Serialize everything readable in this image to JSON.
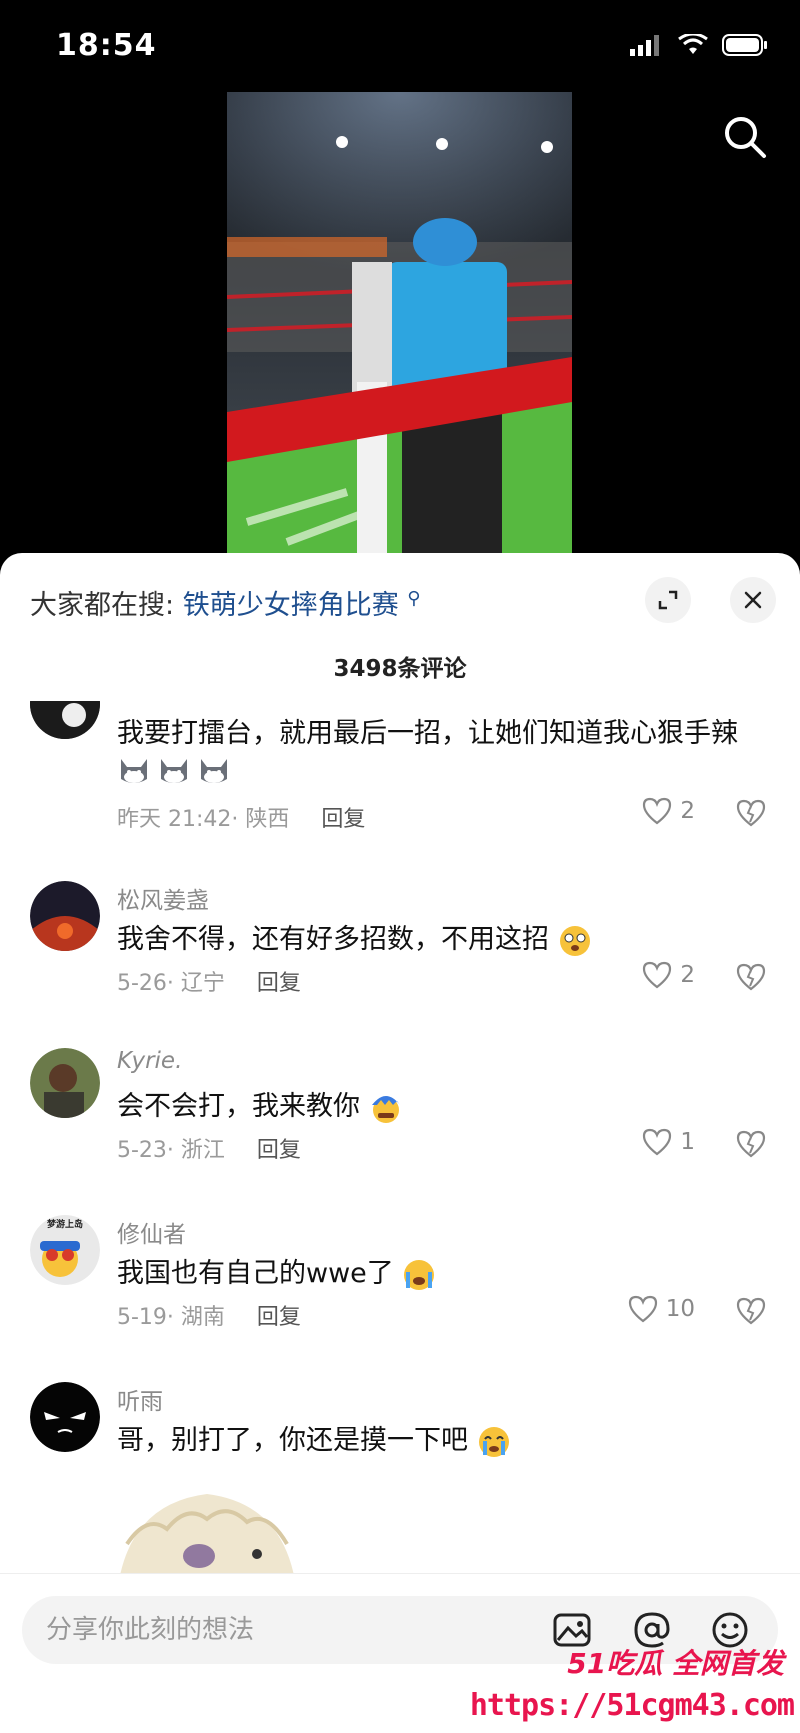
{
  "status_bar": {
    "time": "18:54"
  },
  "sheet": {
    "hot_search_prefix": "大家都在搜:",
    "hot_search_term": "铁萌少女摔角比赛",
    "comment_count": "3498条评论"
  },
  "comments": [
    {
      "username": "",
      "text": "我要打擂台，就用最后一招，让她们知道我心狠手辣",
      "emoji": "cat-face-x3",
      "time_location": "昨天 21:42· 陕西",
      "reply": "回复",
      "likes": "2"
    },
    {
      "username": "松风姜盏",
      "text": "我舍不得，还有好多招数，不用这招",
      "emoji": "dizzy-face",
      "time_location": "5-26· 辽宁",
      "reply": "回复",
      "likes": "2"
    },
    {
      "username": "Kyrie.",
      "text": "会不会打，我来教你",
      "emoji": "angry-blue-hair-face",
      "time_location": "5-23· 浙江",
      "reply": "回复",
      "likes": "1"
    },
    {
      "username": "修仙者",
      "text": "我国也有自己的wwe了",
      "emoji": "crying-face",
      "time_location": "5-19· 湖南",
      "reply": "回复",
      "likes": "10"
    },
    {
      "username": "听雨",
      "text": "哥，别打了，你还是摸一下吧",
      "emoji": "sob-face",
      "time_location": "",
      "reply": "",
      "likes": ""
    }
  ],
  "avatar_labels": {
    "c4_cap": "梦游上岛"
  },
  "input": {
    "placeholder": "分享你此刻的想法"
  },
  "watermark": {
    "brand": "51吃瓜 全网首发",
    "url": "https://51cgm43.com"
  },
  "colors": {
    "link": "#1f4f8f",
    "brand": "#e8154e"
  }
}
